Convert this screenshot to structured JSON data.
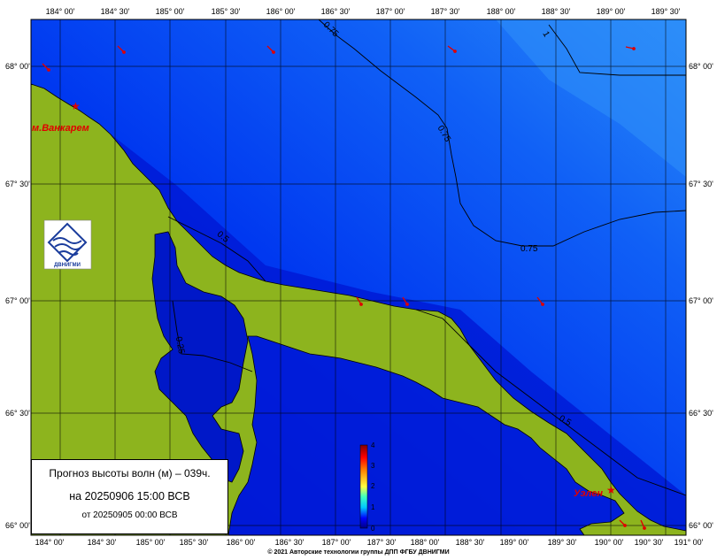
{
  "axes": {
    "lon_ticks": [
      "184° 00'",
      "184° 30'",
      "185° 00'",
      "185° 30'",
      "186° 00'",
      "186° 30'",
      "187° 00'",
      "187° 30'",
      "188° 00'",
      "188° 30'",
      "189° 00'",
      "189° 30'",
      "190° 00'",
      "190° 30'",
      "191° 00'"
    ],
    "lat_ticks": [
      "68° 00'",
      "67° 30'",
      "67° 00'",
      "66° 30'",
      "66° 00'"
    ]
  },
  "contours": {
    "c075_top": "0.75",
    "c075_mid": "0.75",
    "c075_right": "0.75",
    "c05_coast": "0.5",
    "c05_south": "0.5",
    "c025_lagoon": "0.25",
    "c1_top": "1"
  },
  "places": {
    "vankarem": "м.Ванкарем",
    "uelen": "Уэлен"
  },
  "logo": {
    "text": "ДВНИГМИ"
  },
  "colorbar": {
    "ticks": [
      "4",
      "3",
      "2",
      "1",
      "0"
    ]
  },
  "info": {
    "title": "Прогноз высоты волн (м) – 039ч.",
    "forecast_time": "на 20250906 15:00 ВСВ",
    "base_time": "от 20250905 00:00 ВСВ"
  },
  "footer": {
    "copyright": "© 2021 Авторские технологии группы ДПП ФГБУ ДВНИГМИ"
  }
}
